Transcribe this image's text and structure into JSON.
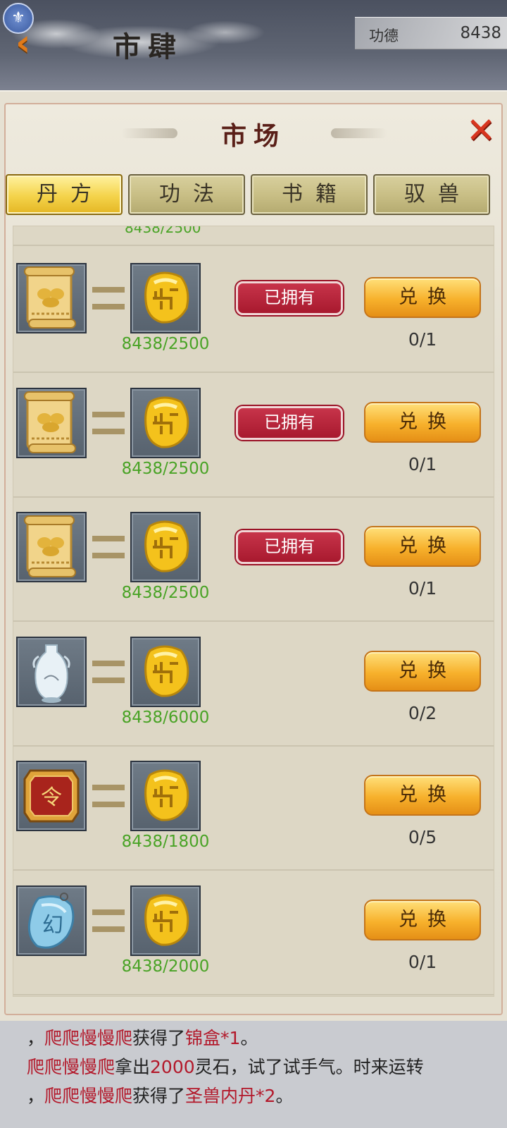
{
  "header": {
    "title": "市肆",
    "merit_label": "功德",
    "merit_value": "8438"
  },
  "dialog": {
    "title": "市场",
    "tabs": [
      {
        "label": "丹方",
        "active": true
      },
      {
        "label": "功法",
        "active": false
      },
      {
        "label": "书籍",
        "active": false
      },
      {
        "label": "驭兽",
        "active": false
      }
    ]
  },
  "items": [
    {
      "icon": "scroll-icon",
      "cost_icon": "spirit-stone-icon",
      "need": "8438/2500",
      "owned_label": "已拥有",
      "button": "兑换",
      "limit": "0/1"
    },
    {
      "icon": "scroll-icon",
      "cost_icon": "spirit-stone-icon",
      "need": "8438/2500",
      "owned_label": "已拥有",
      "button": "兑换",
      "limit": "0/1"
    },
    {
      "icon": "scroll-icon",
      "cost_icon": "spirit-stone-icon",
      "need": "8438/2500",
      "owned_label": "已拥有",
      "button": "兑换",
      "limit": "0/1"
    },
    {
      "icon": "porcelain-vase-icon",
      "cost_icon": "spirit-stone-icon",
      "need": "8438/6000",
      "owned_label": "",
      "button": "兑换",
      "limit": "0/2"
    },
    {
      "icon": "token-plaque-icon",
      "cost_icon": "spirit-stone-icon",
      "need": "8438/1800",
      "owned_label": "",
      "button": "兑换",
      "limit": "0/5"
    },
    {
      "icon": "jade-pendant-icon",
      "cost_icon": "spirit-stone-icon",
      "need": "8438/2000",
      "owned_label": "",
      "button": "兑换",
      "limit": "0/1"
    }
  ],
  "chat": {
    "line1": {
      "prefix": "，",
      "name": "爬爬慢慢爬",
      "mid": "获得了",
      "item": "锦盒*1",
      "suffix": "。"
    },
    "line2": {
      "name": "爬爬慢慢爬",
      "mid": "拿出",
      "amount": "2000",
      "suffix": "灵石，试了试手气。时来运转"
    },
    "line3": {
      "prefix": "，",
      "name": "爬爬慢慢爬",
      "mid": "获得了",
      "item": "圣兽内丹*2",
      "suffix": "。"
    }
  },
  "colors": {
    "need_text": "#49a326",
    "owned_badge": "#b81e33",
    "exchange_button": "#f7b12c",
    "active_tab": "#f4d34a",
    "close_icon": "#d7351f"
  }
}
